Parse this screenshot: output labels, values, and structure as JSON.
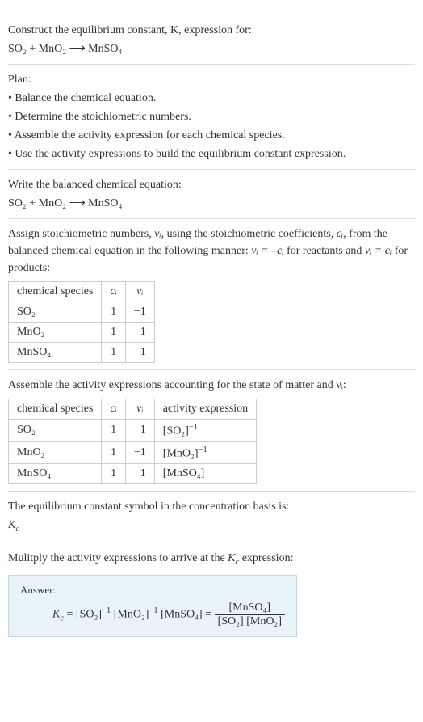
{
  "prompt": {
    "line1": "Construct the equilibrium constant, K, expression for:",
    "equation": "SO₂ + MnO₂  ⟶  MnSO₄"
  },
  "plan": {
    "heading": "Plan:",
    "b1": "• Balance the chemical equation.",
    "b2": "• Determine the stoichiometric numbers.",
    "b3": "• Assemble the activity expression for each chemical species.",
    "b4": "• Use the activity expressions to build the equilibrium constant expression."
  },
  "balanced": {
    "heading": "Write the balanced chemical equation:",
    "equation": "SO₂ + MnO₂  ⟶  MnSO₄"
  },
  "stoich": {
    "text_a": "Assign stoichiometric numbers, ",
    "text_b": ", using the stoichiometric coefficients, ",
    "text_c": ", from the balanced chemical equation in the following manner: ",
    "text_d": " for reactants and ",
    "text_e": " for products:",
    "nu": "νᵢ",
    "ci": "cᵢ",
    "rel_react": "νᵢ = –cᵢ",
    "rel_prod": "νᵢ = cᵢ"
  },
  "table1": {
    "h1": "chemical species",
    "h2": "cᵢ",
    "h3": "νᵢ",
    "r1c1": "SO₂",
    "r1c2": "1",
    "r1c3": "−1",
    "r2c1": "MnO₂",
    "r2c2": "1",
    "r2c3": "−1",
    "r3c1": "MnSO₄",
    "r3c2": "1",
    "r3c3": "1"
  },
  "activity_heading": "Assemble the activity expressions accounting for the state of matter and νᵢ:",
  "table2": {
    "h1": "chemical species",
    "h2": "cᵢ",
    "h3": "νᵢ",
    "h4": "activity expression",
    "r1c1": "SO₂",
    "r1c2": "1",
    "r1c3": "−1",
    "r1c4a": "[SO₂]",
    "r1c4b": "−1",
    "r2c1": "MnO₂",
    "r2c2": "1",
    "r2c3": "−1",
    "r2c4a": "[MnO₂]",
    "r2c4b": "−1",
    "r3c1": "MnSO₄",
    "r3c2": "1",
    "r3c3": "1",
    "r3c4": "[MnSO₄]"
  },
  "symbol": {
    "line": "The equilibrium constant symbol in the concentration basis is:",
    "kc": "Kc",
    "k": "K",
    "c": "c"
  },
  "multiply": {
    "line_a": "Mulitply the activity expressions to arrive at the ",
    "line_b": " expression:"
  },
  "answer": {
    "label": "Answer:",
    "lhs_k": "K",
    "lhs_c": "c",
    "eq": " = ",
    "t1": "[SO₂]",
    "e1": "−1",
    "t2": "[MnO₂]",
    "e2": "−1",
    "t3": "[MnSO₄]",
    "frac_num": "[MnSO₄]",
    "frac_den": "[SO₂] [MnO₂]"
  },
  "chart_data": {
    "type": "table",
    "tables": [
      {
        "columns": [
          "chemical species",
          "c_i",
          "nu_i"
        ],
        "rows": [
          [
            "SO2",
            1,
            -1
          ],
          [
            "MnO2",
            1,
            -1
          ],
          [
            "MnSO4",
            1,
            1
          ]
        ]
      },
      {
        "columns": [
          "chemical species",
          "c_i",
          "nu_i",
          "activity expression"
        ],
        "rows": [
          [
            "SO2",
            1,
            -1,
            "[SO2]^-1"
          ],
          [
            "MnO2",
            1,
            -1,
            "[MnO2]^-1"
          ],
          [
            "MnSO4",
            1,
            1,
            "[MnSO4]"
          ]
        ]
      }
    ]
  }
}
